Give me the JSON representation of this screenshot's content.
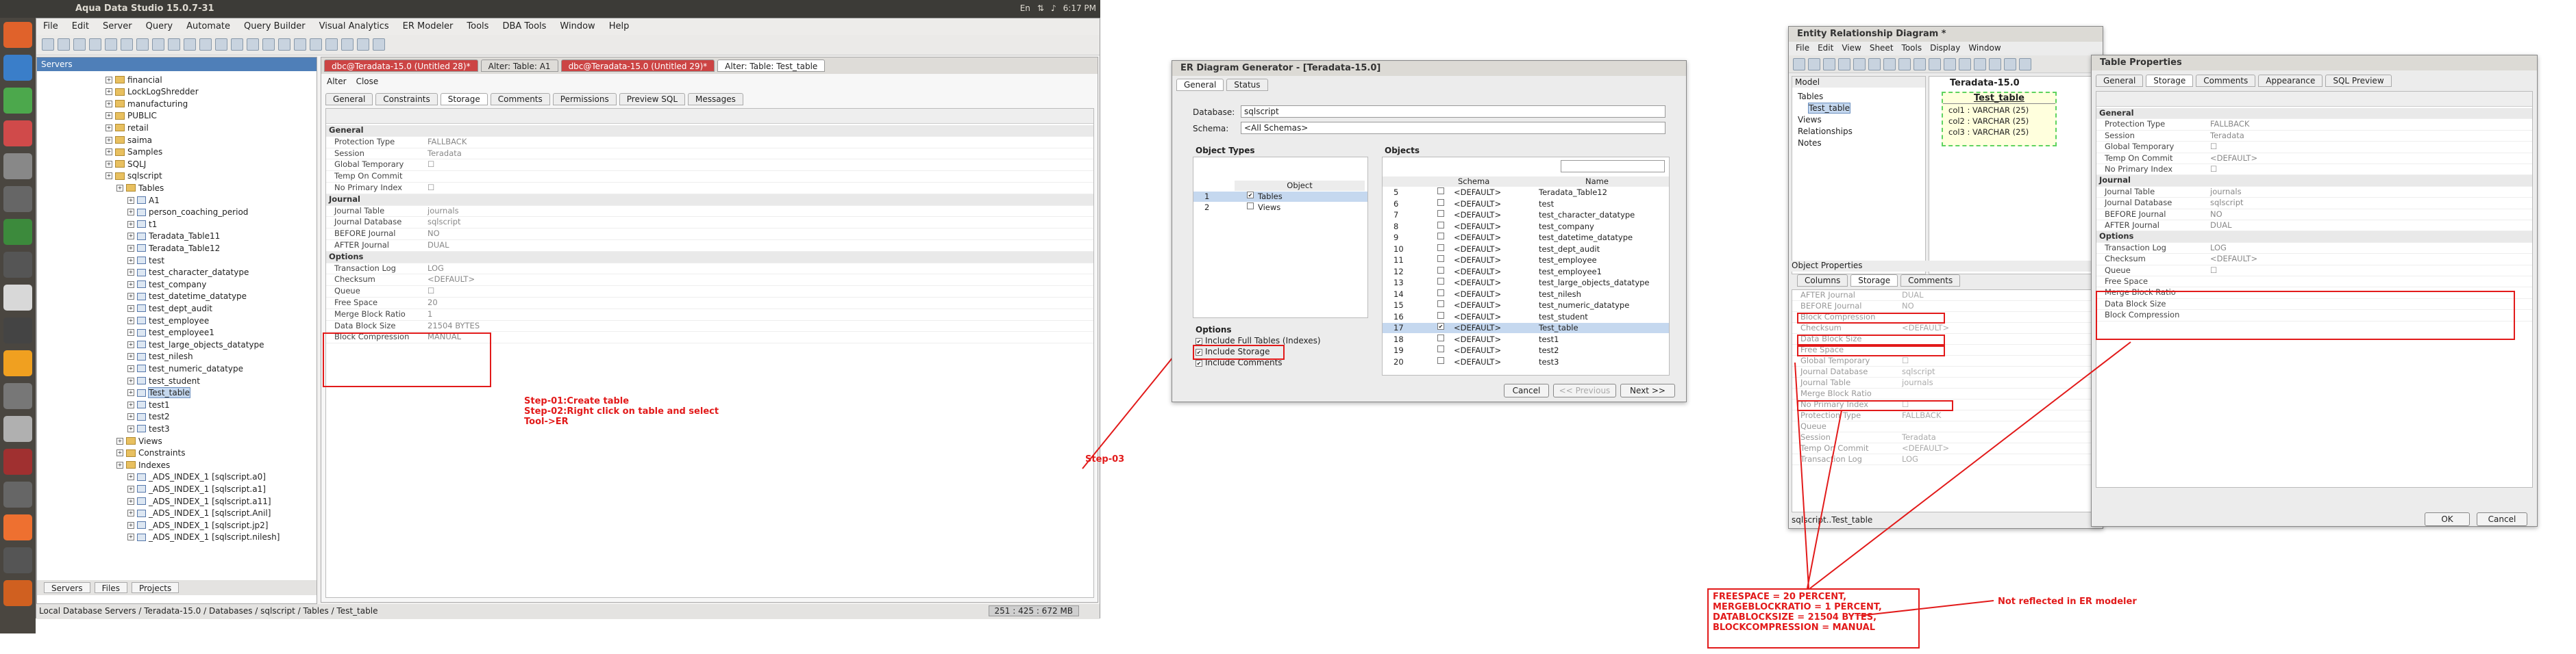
{
  "topbar": {
    "title": "Aqua Data Studio 15.0.7-31",
    "time": "6:17 PM",
    "tray": [
      "En",
      "⇅",
      "♪"
    ]
  },
  "aqua": {
    "title": "Aqua Data Studio 15.0.7-31",
    "menu": [
      "File",
      "Edit",
      "Server",
      "Query",
      "Automate",
      "Query Builder",
      "Visual Analytics",
      "ER Modeler",
      "Tools",
      "DBA Tools",
      "Window",
      "Help"
    ],
    "servers_title": "Servers",
    "tree": [
      {
        "label": "financial",
        "d": 1,
        "icon": "folder"
      },
      {
        "label": "LockLogShredder",
        "d": 1,
        "icon": "folder"
      },
      {
        "label": "manufacturing",
        "d": 1,
        "icon": "folder"
      },
      {
        "label": "PUBLIC",
        "d": 1,
        "icon": "folder"
      },
      {
        "label": "retail",
        "d": 1,
        "icon": "folder"
      },
      {
        "label": "saima",
        "d": 1,
        "icon": "folder"
      },
      {
        "label": "Samples",
        "d": 1,
        "icon": "folder"
      },
      {
        "label": "SQLJ",
        "d": 1,
        "icon": "folder"
      },
      {
        "label": "sqlscript",
        "d": 1,
        "icon": "folder"
      },
      {
        "label": "Tables",
        "d": 2,
        "icon": "folder"
      },
      {
        "label": "A1",
        "d": 3,
        "icon": "table"
      },
      {
        "label": "person_coaching_period",
        "d": 3,
        "icon": "table"
      },
      {
        "label": "t1",
        "d": 3,
        "icon": "table"
      },
      {
        "label": "Teradata_Table11",
        "d": 3,
        "icon": "table"
      },
      {
        "label": "Teradata_Table12",
        "d": 3,
        "icon": "table"
      },
      {
        "label": "test",
        "d": 3,
        "icon": "table"
      },
      {
        "label": "test_character_datatype",
        "d": 3,
        "icon": "table"
      },
      {
        "label": "test_company",
        "d": 3,
        "icon": "table"
      },
      {
        "label": "test_datetime_datatype",
        "d": 3,
        "icon": "table"
      },
      {
        "label": "test_dept_audit",
        "d": 3,
        "icon": "table"
      },
      {
        "label": "test_employee",
        "d": 3,
        "icon": "table"
      },
      {
        "label": "test_employee1",
        "d": 3,
        "icon": "table"
      },
      {
        "label": "test_large_objects_datatype",
        "d": 3,
        "icon": "table"
      },
      {
        "label": "test_nilesh",
        "d": 3,
        "icon": "table"
      },
      {
        "label": "test_numeric_datatype",
        "d": 3,
        "icon": "table"
      },
      {
        "label": "test_student",
        "d": 3,
        "icon": "table"
      },
      {
        "label": "Test_table",
        "d": 3,
        "icon": "table",
        "selected": true
      },
      {
        "label": "test1",
        "d": 3,
        "icon": "table"
      },
      {
        "label": "test2",
        "d": 3,
        "icon": "table"
      },
      {
        "label": "test3",
        "d": 3,
        "icon": "table"
      },
      {
        "label": "Views",
        "d": 2,
        "icon": "folder"
      },
      {
        "label": "Constraints",
        "d": 2,
        "icon": "folder"
      },
      {
        "label": "Indexes",
        "d": 2,
        "icon": "folder"
      },
      {
        "label": "_ADS_INDEX_1 [sqlscript.a0]",
        "d": 3,
        "icon": "table"
      },
      {
        "label": "_ADS_INDEX_1 [sqlscript.a1]",
        "d": 3,
        "icon": "table"
      },
      {
        "label": "_ADS_INDEX_1 [sqlscript.a11]",
        "d": 3,
        "icon": "table"
      },
      {
        "label": "_ADS_INDEX_1 [sqlscript.Anil]",
        "d": 3,
        "icon": "table"
      },
      {
        "label": "_ADS_INDEX_1 [sqlscript.jp2]",
        "d": 3,
        "icon": "table"
      },
      {
        "label": "_ADS_INDEX_1 [sqlscript.nilesh]",
        "d": 3,
        "icon": "table"
      }
    ],
    "server_tabs": [
      "Servers",
      "Files",
      "Projects"
    ],
    "status_path": "Local Database Servers / Teradata-15.0 / Databases / sqlscript / Tables / Test_table",
    "status_mem": "251 : 425 : 672 MB",
    "editor_tabs": [
      {
        "label": "dbc@Teradata-15.0 (Untitled 28)*",
        "style": "red"
      },
      {
        "label": "Alter: Table: A1",
        "style": "normal"
      },
      {
        "label": "dbc@Teradata-15.0 (Untitled 29)*",
        "style": "red"
      },
      {
        "label": "Alter: Table: Test_table",
        "style": "act"
      }
    ],
    "alter_btn": "Alter",
    "close_btn": "Close",
    "prop_tabs": [
      "General",
      "Constraints",
      "Storage",
      "Comments",
      "Permissions",
      "Preview SQL",
      "Messages"
    ],
    "props": [
      {
        "k": "General",
        "v": "",
        "sec": true
      },
      {
        "k": "Protection Type",
        "v": "FALLBACK"
      },
      {
        "k": "Session",
        "v": "Teradata"
      },
      {
        "k": "Global Temporary",
        "v": "☐"
      },
      {
        "k": "Temp On Commit",
        "v": ""
      },
      {
        "k": "No Primary Index",
        "v": "☐"
      },
      {
        "k": "Journal",
        "v": "",
        "sec": true
      },
      {
        "k": "Journal Table",
        "v": "journals"
      },
      {
        "k": "Journal Database",
        "v": "sqlscript"
      },
      {
        "k": "BEFORE Journal",
        "v": "NO"
      },
      {
        "k": "AFTER Journal",
        "v": "DUAL"
      },
      {
        "k": "Options",
        "v": "",
        "sec": true
      },
      {
        "k": "Transaction Log",
        "v": "LOG"
      },
      {
        "k": "Checksum",
        "v": "<DEFAULT>"
      },
      {
        "k": "Queue",
        "v": "☐"
      },
      {
        "k": "Free Space",
        "v": "20"
      },
      {
        "k": "Merge Block Ratio",
        "v": "1"
      },
      {
        "k": "Data Block Size",
        "v": "21504 BYTES"
      },
      {
        "k": "Block Compression",
        "v": "MANUAL"
      }
    ],
    "step_note": [
      "Step-01:Create table",
      "Step-02:Right click on table and select",
      "Tool->ER"
    ]
  },
  "step03": "Step-03",
  "erdlg": {
    "title": "ER Diagram Generator - [Teradata-15.0]",
    "tabs": [
      "General",
      "Status"
    ],
    "db_label": "Database:",
    "db_value": "sqlscript",
    "schema_label": "Schema:",
    "schema_value": "<All Schemas>",
    "objtypes_title": "Object Types",
    "objtypes_hdr": "Object",
    "objtypes": [
      {
        "n": "1",
        "label": "Tables",
        "checked": true,
        "selected": true
      },
      {
        "n": "2",
        "label": "Views",
        "checked": false,
        "selected": false
      }
    ],
    "objects_title": "Objects",
    "objects_hdr": [
      "Schema",
      "Name"
    ],
    "objects": [
      {
        "n": "5",
        "s": "<DEFAULT>",
        "name": "Teradata_Table12",
        "c": false
      },
      {
        "n": "6",
        "s": "<DEFAULT>",
        "name": "test",
        "c": false
      },
      {
        "n": "7",
        "s": "<DEFAULT>",
        "name": "test_character_datatype",
        "c": false
      },
      {
        "n": "8",
        "s": "<DEFAULT>",
        "name": "test_company",
        "c": false
      },
      {
        "n": "9",
        "s": "<DEFAULT>",
        "name": "test_datetime_datatype",
        "c": false
      },
      {
        "n": "10",
        "s": "<DEFAULT>",
        "name": "test_dept_audit",
        "c": false
      },
      {
        "n": "11",
        "s": "<DEFAULT>",
        "name": "test_employee",
        "c": false
      },
      {
        "n": "12",
        "s": "<DEFAULT>",
        "name": "test_employee1",
        "c": false
      },
      {
        "n": "13",
        "s": "<DEFAULT>",
        "name": "test_large_objects_datatype",
        "c": false
      },
      {
        "n": "14",
        "s": "<DEFAULT>",
        "name": "test_nilesh",
        "c": false
      },
      {
        "n": "15",
        "s": "<DEFAULT>",
        "name": "test_numeric_datatype",
        "c": false
      },
      {
        "n": "16",
        "s": "<DEFAULT>",
        "name": "test_student",
        "c": false
      },
      {
        "n": "17",
        "s": "<DEFAULT>",
        "name": "Test_table",
        "c": true,
        "sel": true
      },
      {
        "n": "18",
        "s": "<DEFAULT>",
        "name": "test1",
        "c": false
      },
      {
        "n": "19",
        "s": "<DEFAULT>",
        "name": "test2",
        "c": false
      },
      {
        "n": "20",
        "s": "<DEFAULT>",
        "name": "test3",
        "c": false
      }
    ],
    "options_title": "Options",
    "options": [
      {
        "label": "Include Full Tables (Indexes)",
        "checked": true
      },
      {
        "label": "Include Storage",
        "checked": true
      },
      {
        "label": "Include Comments",
        "checked": true
      }
    ],
    "buttons": [
      "Cancel",
      "<< Previous",
      "Next >>"
    ]
  },
  "erd": {
    "title": "Entity Relationship Diagram *",
    "menu": [
      "File",
      "Edit",
      "View",
      "Sheet",
      "Tools",
      "Display",
      "Window"
    ],
    "model_title": "Model",
    "model_tree": [
      {
        "label": "Tables",
        "d": 0
      },
      {
        "label": "Test_table",
        "d": 1
      },
      {
        "label": "Views",
        "d": 0
      },
      {
        "label": "Relationships",
        "d": 0
      },
      {
        "label": "Notes",
        "d": 0
      }
    ],
    "canvas_title": "Teradata-15.0",
    "entity_name": "Test_table",
    "entity_cols": [
      "col1 : VARCHAR (25)",
      "col2 : VARCHAR (25)",
      "col3 : VARCHAR (25)"
    ],
    "objprops_title": "Object Properties",
    "objprops_tabs": [
      "Columns",
      "Storage",
      "Comments"
    ],
    "objprops": [
      "AFTER Journal",
      "BEFORE Journal",
      "Block Compression",
      "Checksum",
      "Data Block Size",
      "Free Space",
      "Global Temporary",
      "Journal Database",
      "Journal Table",
      "Merge Block Ratio",
      "No Primary Index",
      "Protection Type",
      "Queue",
      "Session",
      "Temp On Commit",
      "Transaction Log"
    ],
    "objprops_vals": [
      "DUAL",
      "NO",
      "",
      "<DEFAULT>",
      "",
      "",
      "☐",
      "sqlscript",
      "journals",
      "",
      "☐",
      "FALLBACK",
      "",
      "Teradata",
      "<DEFAULT>",
      "LOG"
    ],
    "status": "sqlscript..Test_table"
  },
  "tp": {
    "title": "Table Properties",
    "tabs": [
      "General",
      "Storage",
      "Comments",
      "Appearance",
      "SQL Preview"
    ],
    "props": [
      {
        "k": "General",
        "v": "",
        "sec": true
      },
      {
        "k": "Protection Type",
        "v": "FALLBACK"
      },
      {
        "k": "Session",
        "v": "Teradata"
      },
      {
        "k": "Global Temporary",
        "v": "☐"
      },
      {
        "k": "Temp On Commit",
        "v": "<DEFAULT>"
      },
      {
        "k": "No Primary Index",
        "v": "☐"
      },
      {
        "k": "Journal",
        "v": "",
        "sec": true
      },
      {
        "k": "Journal Table",
        "v": "journals"
      },
      {
        "k": "Journal Database",
        "v": "sqlscript"
      },
      {
        "k": "BEFORE Journal",
        "v": "NO"
      },
      {
        "k": "AFTER Journal",
        "v": "DUAL"
      },
      {
        "k": "Options",
        "v": "",
        "sec": true
      },
      {
        "k": "Transaction Log",
        "v": "LOG"
      },
      {
        "k": "Checksum",
        "v": "<DEFAULT>"
      },
      {
        "k": "Queue",
        "v": "☐"
      },
      {
        "k": "Free Space",
        "v": ""
      },
      {
        "k": "Merge Block Ratio",
        "v": ""
      },
      {
        "k": "Data Block Size",
        "v": ""
      },
      {
        "k": "Block Compression",
        "v": ""
      }
    ],
    "ok": "OK",
    "cancel": "Cancel"
  },
  "note_box": [
    "FREESPACE = 20 PERCENT,",
    "MERGEBLOCKRATIO = 1 PERCENT,",
    "DATABLOCKSIZE = 21504 BYTES,",
    "BLOCKCOMPRESSION = MANUAL"
  ],
  "not_reflected": "Not reflected in ER modeler",
  "colors": {
    "red": "#e21a1a",
    "launcher": "#4a4640",
    "topbar": "#3c3b37"
  }
}
